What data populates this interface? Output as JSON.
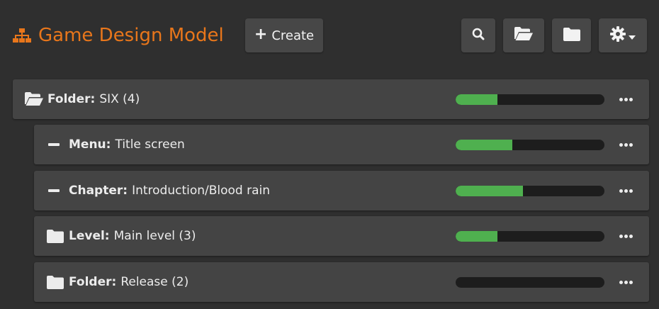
{
  "header": {
    "title": "Game Design Model",
    "brand_color": "#e8761b",
    "create_label": "Create"
  },
  "toolbar": {
    "search_icon": "search-icon",
    "open_folder_icon": "folder-open-icon",
    "folder_icon": "folder-icon",
    "settings_icon": "gear-icon"
  },
  "tree": {
    "root": {
      "type": "Folder:",
      "name": "SIX (4)",
      "icon": "folder-open-icon",
      "progress": 0.28
    },
    "children": [
      {
        "type": "Menu:",
        "name": "Title screen",
        "icon": "minus-icon",
        "progress": 0.38
      },
      {
        "type": "Chapter:",
        "name": "Introduction/Blood rain",
        "icon": "minus-icon",
        "progress": 0.45
      },
      {
        "type": "Level:",
        "name": "Main level (3)",
        "icon": "folder-icon",
        "progress": 0.28
      },
      {
        "type": "Folder:",
        "name": "Release (2)",
        "icon": "folder-icon",
        "progress": 0.0
      }
    ]
  },
  "colors": {
    "progress_fill": "#4fb04f",
    "progress_track": "#1d1d1d",
    "row_background": "#444444",
    "page_background": "#2f2f2f"
  }
}
